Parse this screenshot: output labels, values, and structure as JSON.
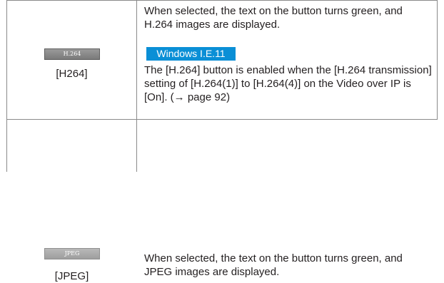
{
  "rows": [
    {
      "button_label": "H.264",
      "caption": "[H264]",
      "description": "When selected, the text on the button turns green, and H.264 images are displayed.",
      "badge": "Windows I.E.11",
      "note": "The [H.264] button is enabled when the [H.264 transmission] setting of [H.264(1)] to [H.264(4)] on the Video over IP is [On]. (→ page 92)"
    },
    {
      "button_label": "JPEG",
      "caption": "[JPEG]",
      "description": "When selected, the text on the button turns green, and JPEG images are displayed."
    }
  ],
  "colors": {
    "badge_background": "#0a8fd6",
    "border": "#8a8a8a",
    "text": "#231f20"
  }
}
